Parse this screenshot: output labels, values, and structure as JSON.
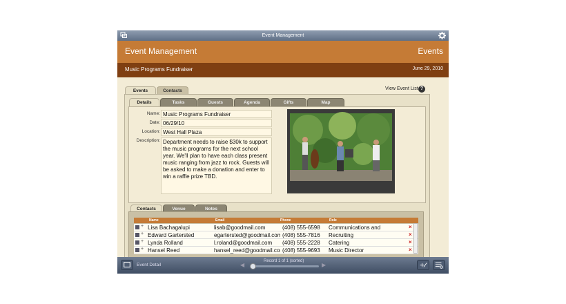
{
  "window": {
    "title": "Event Management"
  },
  "header": {
    "app_title": "Event Management",
    "section_title": "Events"
  },
  "record_bar": {
    "record_name": "Music Programs Fundraiser",
    "record_date": "June 29, 2010"
  },
  "top_tabs": [
    "Events",
    "Contacts"
  ],
  "view_event_list": "View Event List",
  "help": "?",
  "sub_tabs": [
    "Details",
    "Tasks",
    "Guests",
    "Agenda",
    "Gifts",
    "Map"
  ],
  "details": {
    "name_label": "Name:",
    "name_value": "Music Programs Fundraiser",
    "date_label": "Date:",
    "date_value": "06/29/10",
    "location_label": "Location:",
    "location_value": "West Hall Plaza",
    "description_label": "Description:",
    "description_value": "Department needs to raise $30k to support the music programs for the next school year. We'll plan to have each class present music ranging from jazz to rock. Guests will be asked to make a donation and enter to win a raffle prize TBD."
  },
  "bottom_tabs": [
    "Contacts",
    "Venue",
    "Notes"
  ],
  "contacts_table": {
    "columns": [
      "Name",
      "Email",
      "Phone",
      "Role"
    ],
    "rows": [
      {
        "name": "Lisa  Bachagalupi",
        "email": "lisab@goodmail.com",
        "phone": "(408) 555-6598",
        "role": "Communications and"
      },
      {
        "name": "Edward Gartersted",
        "email": "egartersted@goodmail.com",
        "phone": "(408) 555-7816",
        "role": "Recruiting"
      },
      {
        "name": "Lynda Rolland",
        "email": "l.roland@goodmail.com",
        "phone": "(408) 555-2228",
        "role": "Catering"
      },
      {
        "name": "Hansel Reed",
        "email": "hansel_reed@goodmail.com",
        "phone": "(408) 555-9693",
        "role": "Music Director"
      }
    ]
  },
  "footer": {
    "layout_label": "Event Detail",
    "record_status": "Record 1 of 1 (sorted)"
  },
  "colors": {
    "accent_orange": "#c57b36",
    "brown": "#7f3f12",
    "background": "#f3ecd6"
  }
}
